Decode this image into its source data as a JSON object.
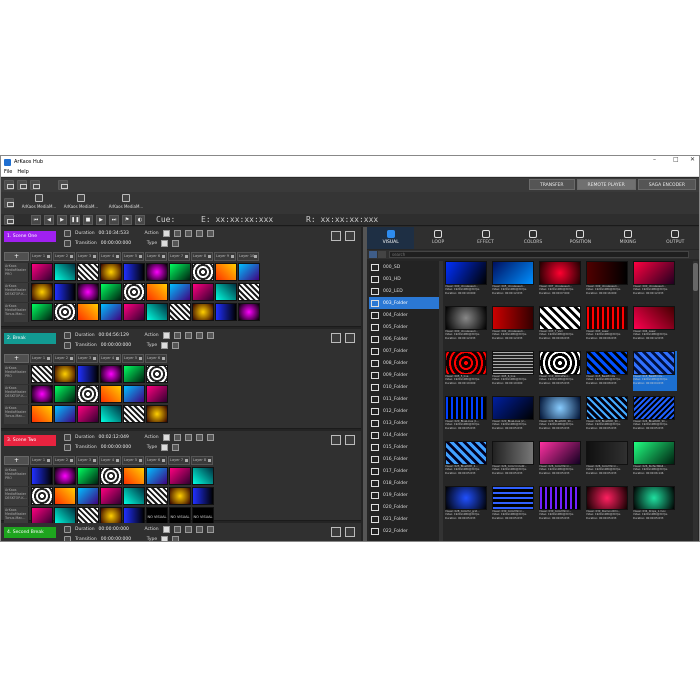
{
  "window": {
    "title": "ArKaos Hub",
    "minimize": "–",
    "maximize": "□",
    "close": "✕"
  },
  "menu": [
    "File",
    "Help"
  ],
  "right_tabs": [
    "TRANSFER",
    "REMOTE PLAYER",
    "SAGA ENCODER"
  ],
  "active_right_tab": "REMOTE PLAYER",
  "outputs": [
    "ArKaos MediaM...",
    "ArKaos MediaM...",
    "ArKaos MediaM..."
  ],
  "transport": {
    "cue": "Cue:",
    "end": "E: xx:xx:xx:xxx",
    "remain": "R: xx:xx:xx:xxx"
  },
  "labels": {
    "duration": "Duration",
    "transition": "Transition",
    "action": "Action",
    "type": "Type"
  },
  "layer_names": [
    "Layer 1",
    "Layer 2",
    "Layer 3",
    "Layer 4",
    "Layer 5",
    "Layer 6",
    "Layer 7",
    "Layer 8",
    "Layer 9",
    "Layer 10"
  ],
  "device_labels": [
    "ArKaos MediaMaster PRO",
    "ArKaos MediaMaster DESKTOP-K...",
    "ArKaos MediaMaster Tonus-Mac..."
  ],
  "no_visual": "NO VISUAL",
  "scenes": [
    {
      "name": "1. Scene One",
      "color": "#a020f0",
      "duration": "00:10:34:533",
      "transition": "00:00:00:000"
    },
    {
      "name": "2. Break",
      "color": "#129a92",
      "duration": "00:04:56:129",
      "transition": "00:00:00:000"
    },
    {
      "name": "3. Scene Two",
      "color": "#e8233f",
      "duration": "00:02:12:049",
      "transition": "00:00:00:000"
    },
    {
      "name": "4. Second Break",
      "color": "#1ea51e",
      "duration": "00:00:00:000",
      "transition": "00:00:00:000"
    }
  ],
  "browser_tabs": [
    "VISUAL",
    "LOOP",
    "EFFECT",
    "COLORS",
    "POSITION",
    "MIXING",
    "OUTPUT"
  ],
  "search": {
    "placeholder": "search"
  },
  "folders": [
    "000_SD",
    "001_HD",
    "002_LED",
    "003_Folder",
    "004_Folder",
    "005_Folder",
    "006_Folder",
    "007_Folder",
    "008_Folder",
    "009_Folder",
    "010_Folder",
    "011_Folder",
    "012_Folder",
    "013_Folder",
    "014_Folder",
    "015_Folder",
    "016_Folder",
    "017_Folder",
    "018_Folder",
    "019_Folder",
    "020_Folder",
    "021_Folder",
    "022_Folder"
  ],
  "selected_folder": "003_Folder",
  "visuals": [
    [
      "Visual: 000_Unreleased...",
      "Video: 1920x1080@30 fps",
      "Duration: 00:00:10:000"
    ],
    [
      "Visual: 005_Unreleased...",
      "Video: 1920x1080@30 fps",
      "Duration: 00:00:12:033"
    ],
    [
      "Visual: 007_Unreleased...",
      "Video: 1920x1080@30 fps",
      "Duration: 00:00:07:000"
    ],
    [
      "Visual: 009_Unreleased...",
      "Video: 1920x1080@30 fps",
      "Duration: 00:00:16:000"
    ],
    [
      "Visual: 000_Unreleased...",
      "Video: 1920x1080@30 fps",
      "Duration: 00:00:12:033"
    ],
    [
      "Visual: 000_Unreleased...",
      "Video: 1920x1080@30 fps",
      "Duration: 00:00:12:033"
    ],
    [
      "Visual: 002_Unreleased...",
      "Video: 1920x1080@30 fps",
      "Duration: 00:00:12:033"
    ],
    [
      "Visual: 003_7_Vari",
      "Video: 1920x1080@30 fps",
      "Duration: 00:00:06:033"
    ],
    [
      "Visual: 003_Laser",
      "Video: 1920x1080@30 fps",
      "Duration: 00:00:06:033"
    ],
    [
      "Visual: 004_Laser",
      "Video: 1920x1080@30 fps",
      "Duration: 00:00:12:033"
    ],
    [
      "Visual: 005_5_line",
      "Video: 1920x1080@30 fps",
      "Duration: 00:00:10:000"
    ],
    [
      "Visual: 005_6_line",
      "Video: 1920x1080@30 fps",
      "Duration: 00:00:10:000"
    ],
    [
      "Visual: 010_CIRCLEsol...",
      "Video: 1920x1080@30 fps",
      "Duration: 00:00:05:033"
    ],
    [
      "Visual: 015_BeatPrints",
      "Video: 1920x1080@30 fps",
      "Duration: 00:00:08:033"
    ],
    [
      "Visual: 015_BeatPrints...",
      "Video: 1920x1080@30 fps",
      "Duration: 00:00:04:033"
    ],
    [
      "Visual: 020_BlueLines (1...",
      "Video: 1920x1080@30 fps",
      "Duration: 00:00:05:033"
    ],
    [
      "Visual: 020_BlueLines (2...",
      "Video: 1920x1080@30 fps",
      "Duration: 00:00:05:033"
    ],
    [
      "Visual: 020_BlueWith_Sh...",
      "Video: 1920x1080@30 fps",
      "Duration: 00:00:05:033"
    ],
    [
      "Visual: 020_BlueWith_Sh...",
      "Video: 1920x1080@30 fps",
      "Duration: 00:00:05:033"
    ],
    [
      "Visual: 024_BlueWith_Sh...",
      "Video: 1920x1080@30 fps",
      "Duration: 00:00:05:033"
    ],
    [
      "Visual: 025_BlueWith_2...",
      "Video: 1920x1080@30 fps",
      "Duration: 00:00:05:033"
    ],
    [
      "Visual: 026_ColorCircleW...",
      "Video: 1920x1080@30 fps",
      "Duration: 00:00:05:033"
    ],
    [
      "Visual: 026_ColorMirror...",
      "Video: 1920x1080@30 fps",
      "Duration: 00:00:05:033"
    ],
    [
      "Visual: 026_ColorMirror...",
      "Video: 1920x1080@30 fps",
      "Duration: 00:00:05:033"
    ],
    [
      "Visual: 026_PerfectWall...",
      "Video: 1920x1080@30 fps",
      "Duration: 00:00:06:146"
    ],
    [
      "Visual: 028_Colorful_grid...",
      "Video: 1920x1080@30 fps",
      "Duration: 00:00:05:033"
    ],
    [
      "Visual: 030_ColorMirror...",
      "Video: 1920x1080@30 fps",
      "Duration: 00:00:05:033"
    ],
    [
      "Visual: 030_ColorMirror...",
      "Video: 1920x1080@30 fps",
      "Duration: 00:00:05:033"
    ],
    [
      "Visual: 030_DiamondChi...",
      "Video: 1920x1080@30 fps",
      "Duration: 00:00:05:033"
    ],
    [
      "Visual: 034_Drops_1.mov",
      "Video: 1920x1080@30 fps",
      "Duration: 00:00:05:033"
    ]
  ],
  "selected_visual_index": 14
}
